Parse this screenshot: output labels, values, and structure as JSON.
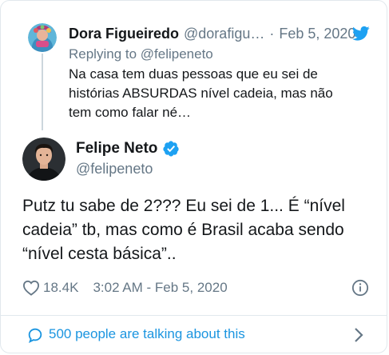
{
  "parent_tweet": {
    "author_name": "Dora Figueiredo",
    "author_handle": "@dorafigu…",
    "separator": "·",
    "date": "Feb 5, 2020",
    "replying_to": "Replying to @felipeneto",
    "text_lines": [
      "Na casa tem duas pessoas que eu sei de",
      "histórias ABSURDAS nível cadeia, mas não",
      "tem como falar né…"
    ]
  },
  "main_tweet": {
    "author_name": "Felipe Neto",
    "author_handle": "@felipeneto",
    "text_lines": [
      "Putz tu sabe de 2??? Eu sei de 1... É “nível",
      "cadeia” tb, mas como é Brasil acaba sendo",
      "“nível cesta básica”.."
    ],
    "like_count": "18.4K",
    "timestamp": "3:02 AM - Feb 5, 2020"
  },
  "footer": {
    "talking_text": "500 people are talking about this"
  },
  "colors": {
    "brand_blue": "#1da1f2",
    "link_blue": "#1b95e0",
    "muted_text": "#657786",
    "primary_text": "#14171a",
    "border": "#e1e8ed"
  },
  "icons": {
    "brand": "twitter-bird-icon",
    "verified": "verified-badge-icon",
    "like": "heart-icon",
    "info": "info-icon",
    "conversation": "speech-bubble-icon",
    "navigate": "chevron-right-icon"
  }
}
